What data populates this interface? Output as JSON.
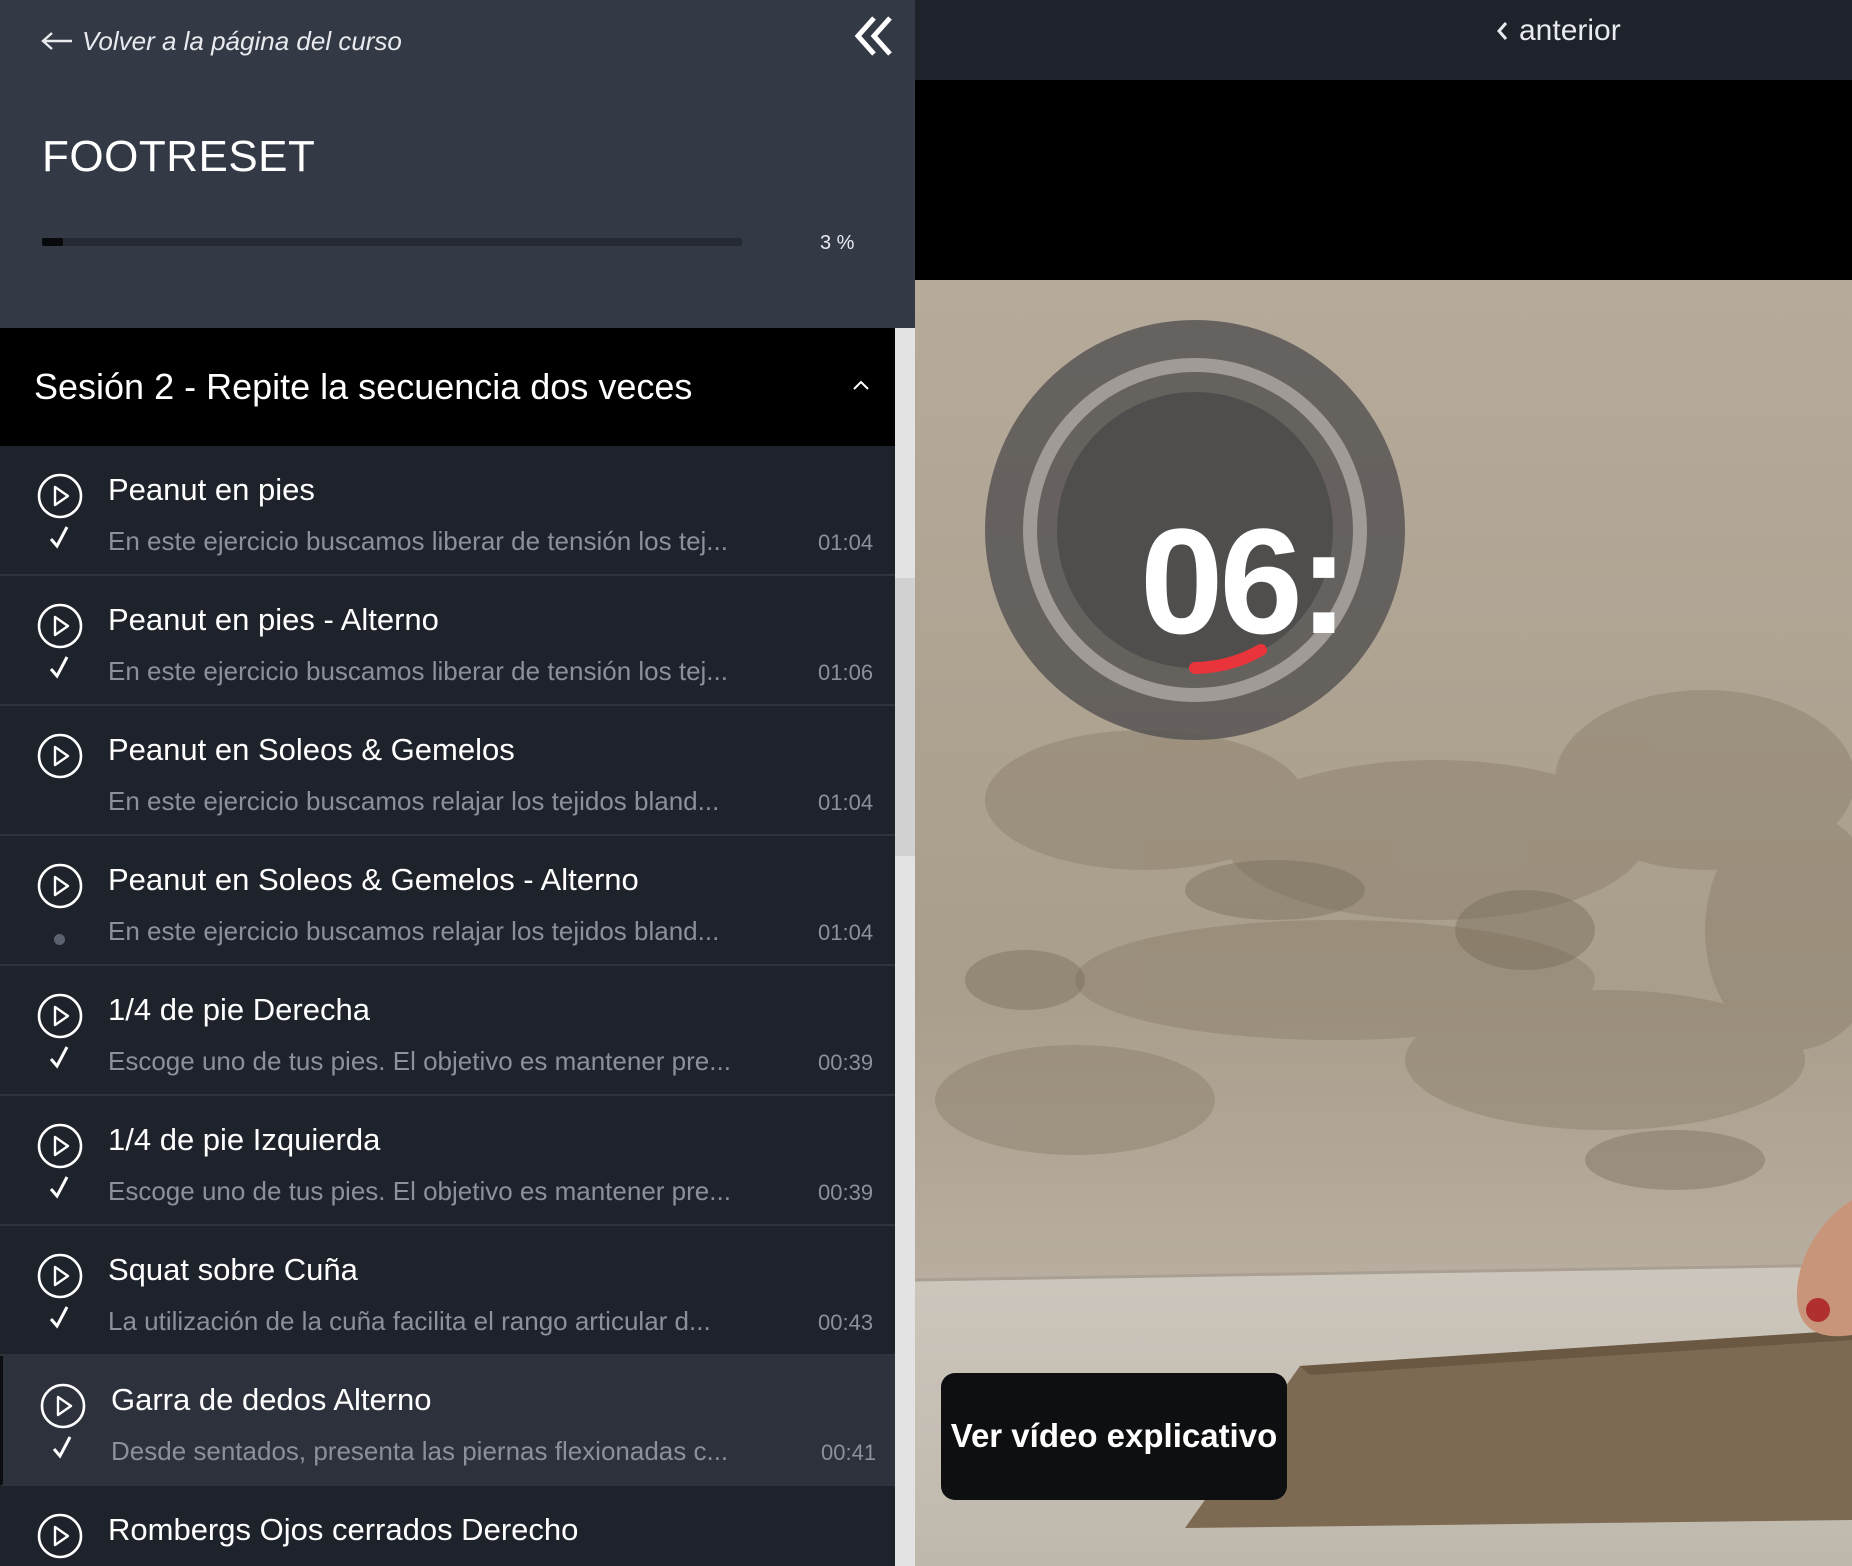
{
  "sidebar": {
    "back_link": "Volver a la página del curso",
    "course_title": "FOOTRESET",
    "progress": {
      "value": 0.03,
      "label": "3 %"
    },
    "section": {
      "title": "Sesión 2 - Repite la secuencia dos veces"
    },
    "lessons": [
      {
        "title": "Peanut en pies",
        "description": "En este ejercicio buscamos liberar de tensión los tej...",
        "duration": "01:04",
        "status": "completed"
      },
      {
        "title": "Peanut en pies - Alterno",
        "description": "En este ejercicio buscamos liberar de tensión los tej...",
        "duration": "01:06",
        "status": "completed"
      },
      {
        "title": "Peanut en Soleos & Gemelos",
        "description": "En este ejercicio buscamos relajar los tejidos bland...",
        "duration": "01:04",
        "status": "none"
      },
      {
        "title": "Peanut en Soleos & Gemelos - Alterno",
        "description": "En este ejercicio buscamos relajar los tejidos bland...",
        "duration": "01:04",
        "status": "pending"
      },
      {
        "title": "1/4 de pie Derecha",
        "description": "Escoge uno de tus pies. El objetivo es mantener pre...",
        "duration": "00:39",
        "status": "completed"
      },
      {
        "title": "1/4 de pie Izquierda",
        "description": "Escoge uno de tus pies. El objetivo es mantener pre...",
        "duration": "00:39",
        "status": "completed"
      },
      {
        "title": "Squat sobre Cuña",
        "description": "La utilización de la cuña facilita el rango articular d...",
        "duration": "00:43",
        "status": "completed"
      },
      {
        "title": "Garra de dedos Alterno",
        "description": "Desde sentados, presenta las piernas flexionadas c...",
        "duration": "00:41",
        "status": "completed",
        "active": true
      },
      {
        "title": "Rombergs Ojos cerrados Derecho",
        "description": "",
        "duration": "",
        "status": "none"
      }
    ]
  },
  "topbar": {
    "prev_label": "anterior"
  },
  "video": {
    "timer_text": "06:",
    "explain_button": "Ver vídeo explicativo"
  },
  "colors": {
    "sidebar_header_bg": "#343946",
    "sidebar_bg": "#1e222a",
    "timer_accent": "#e8343a",
    "wall": "#b9ad9d"
  },
  "icons": {
    "back": "arrow-left-icon",
    "collapse": "double-chevron-left-icon",
    "section_toggle": "chevron-up-icon",
    "play": "play-circle-icon",
    "check": "check-icon",
    "prev": "chevron-left-icon"
  }
}
